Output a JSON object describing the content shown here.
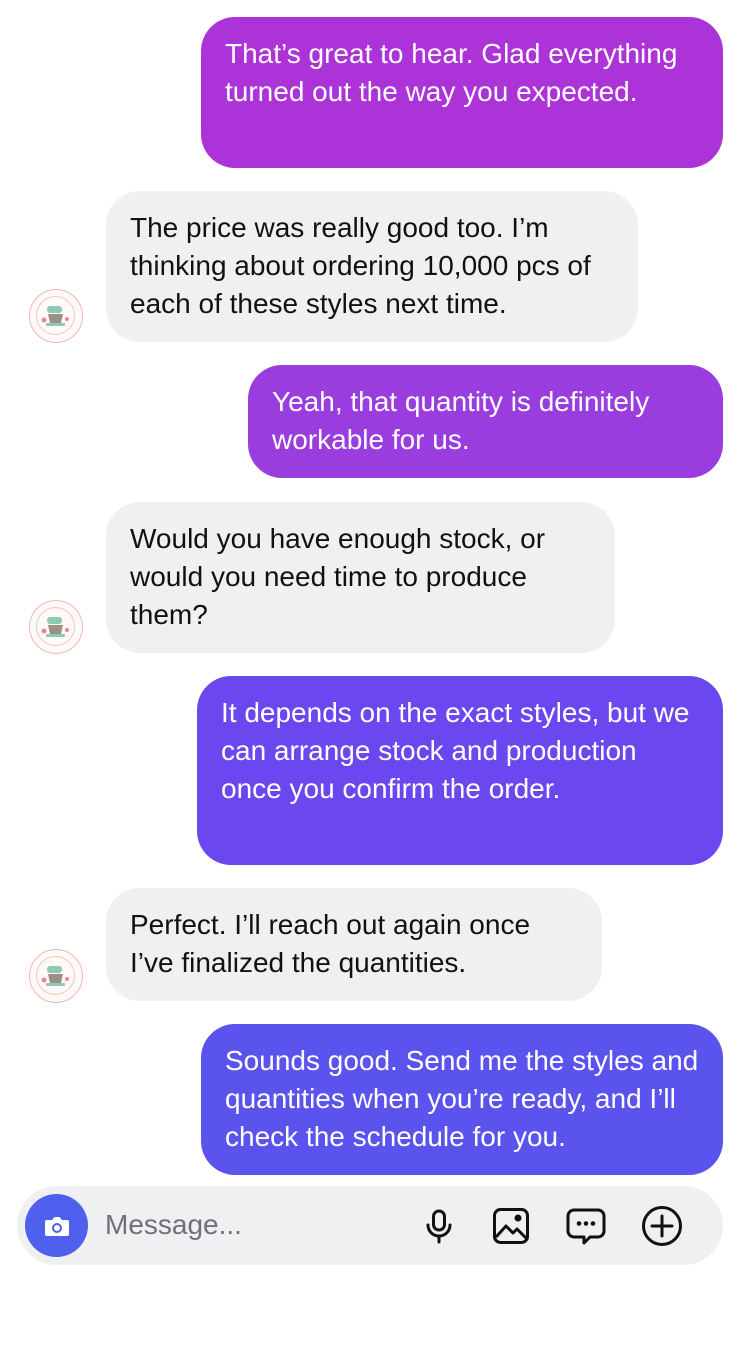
{
  "messages": [
    {
      "from": "me",
      "text": "That’s great to hear. Glad everything turned out the way you expected."
    },
    {
      "from": "contact",
      "text": "The price was really good too. I’m thinking about ordering 10,000 pcs of each of these styles next time."
    },
    {
      "from": "me",
      "text": "Yeah, that quantity is definitely workable for us."
    },
    {
      "from": "contact",
      "text": "Would you have enough stock, or would you need time to produce them?"
    },
    {
      "from": "me",
      "text": "It depends on the exact styles, but we can arrange stock and production once you confirm the order."
    },
    {
      "from": "contact",
      "text": "Perfect. I’ll reach out again once I’ve finalized the quantities."
    },
    {
      "from": "me",
      "text": "Sounds good. Send me the styles and quantities when you’re ready, and I’ll check the schedule for you."
    }
  ],
  "composer": {
    "placeholder": "Message...",
    "icons": [
      "camera-icon",
      "microphone-icon",
      "gallery-icon",
      "sticker-icon",
      "plus-icon"
    ]
  },
  "colors": {
    "out_gradient_top": "#b134d8",
    "out_gradient_bottom": "#5850ec",
    "incoming_bubble": "#eff0f2",
    "camera_button": "#4f60ef"
  }
}
